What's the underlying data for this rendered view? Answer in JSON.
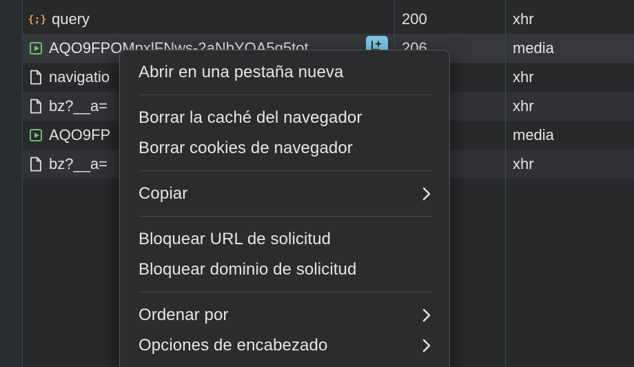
{
  "requests": [
    {
      "icon": "brace-icon",
      "name": "query",
      "status": "200",
      "type": "xhr"
    },
    {
      "icon": "media-icon",
      "name": "AQO9FPOMpxlFNws-2aNbYOA5g5tot",
      "status": "206",
      "type": "media"
    },
    {
      "icon": "document-icon",
      "name": "navigatio",
      "status": "",
      "type": "xhr"
    },
    {
      "icon": "document-icon",
      "name": "bz?__a=",
      "status": "",
      "type": "xhr"
    },
    {
      "icon": "media-icon",
      "name": "AQO9FP",
      "status": "",
      "type": "media"
    },
    {
      "icon": "document-icon",
      "name": "bz?__a=",
      "status": "",
      "type": "xhr"
    }
  ],
  "context_menu": {
    "open_new_tab": "Abrir en una pestaña nueva",
    "clear_cache": "Borrar la caché del navegador",
    "clear_cookies": "Borrar cookies de navegador",
    "copy": "Copiar",
    "block_url": "Bloquear URL de solicitud",
    "block_domain": "Bloquear dominio de solicitud",
    "sort_by": "Ordenar por",
    "header_options": "Opciones de encabezado"
  },
  "colors": {
    "accent_media": "#6fbf73",
    "accent_brace": "#e2984c",
    "ai_badge": "#7cc8e6"
  }
}
